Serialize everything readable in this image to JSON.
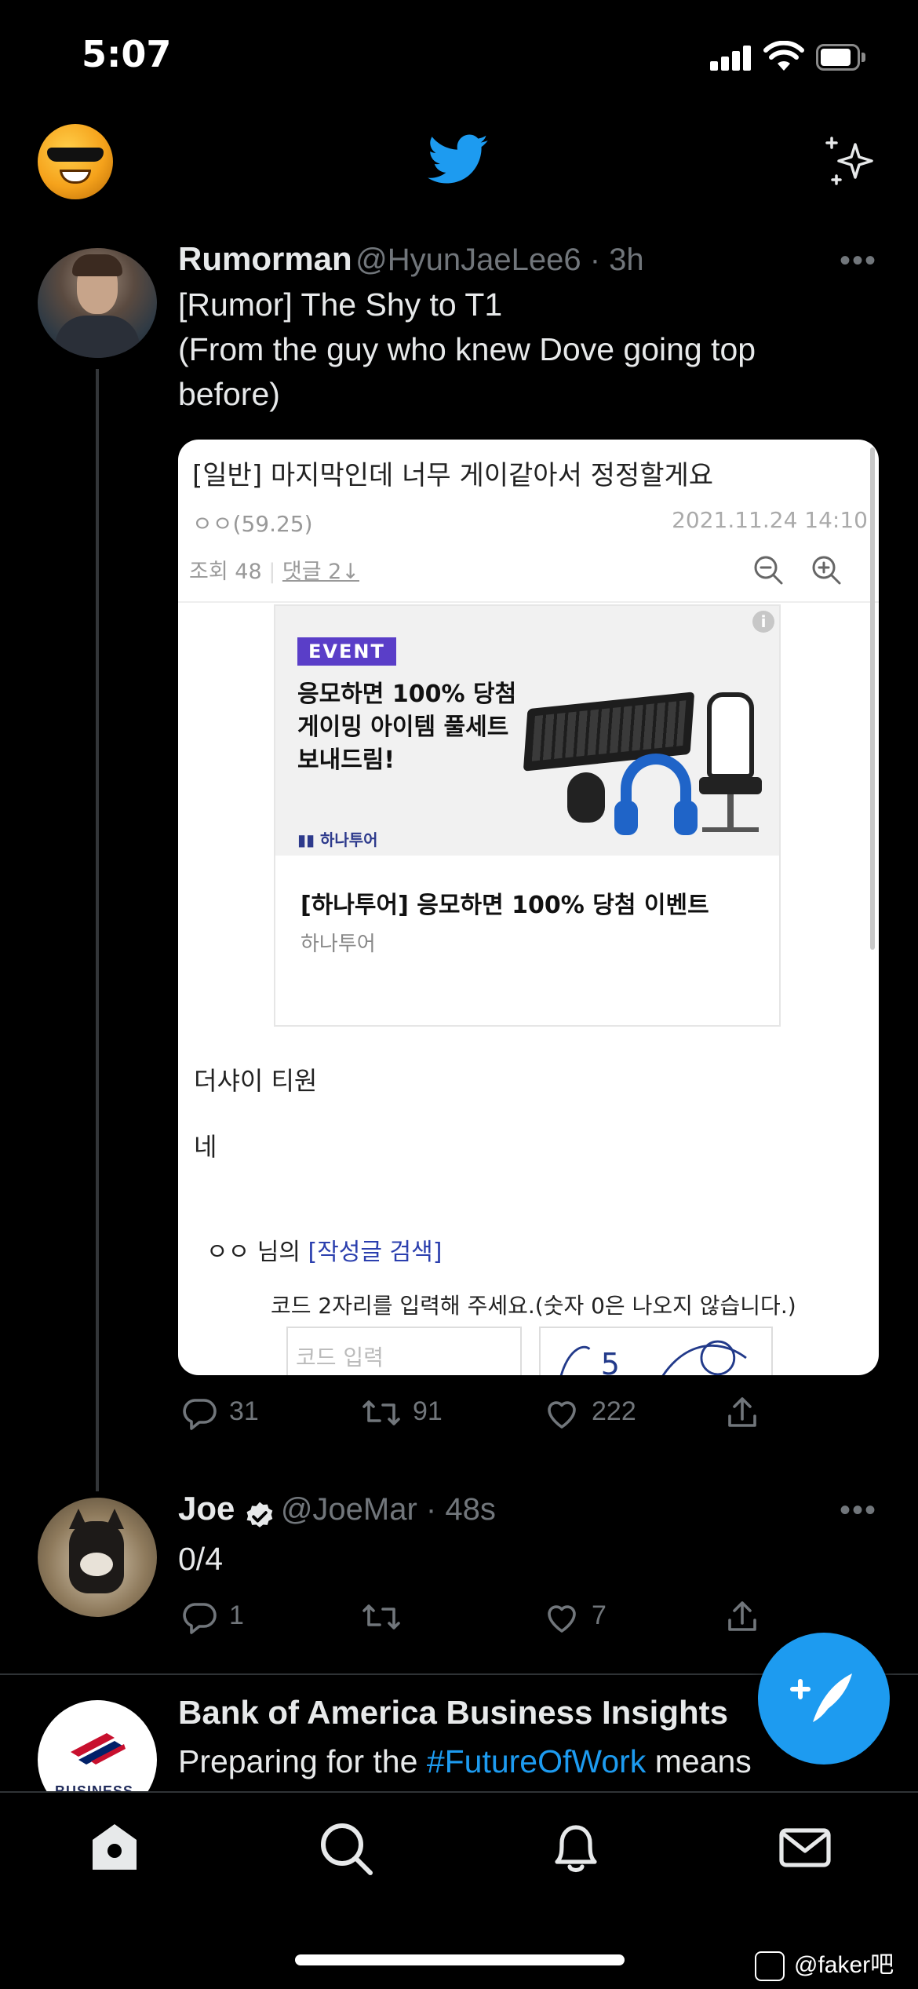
{
  "status_bar": {
    "time": "5:07"
  },
  "tweets": [
    {
      "name": "Rumorman",
      "handle": "@HyunJaeLee6",
      "age": "3h",
      "text_lines": [
        "[Rumor] The Shy to T1",
        "(From the guy who knew Dove going top",
        "before)"
      ],
      "replies": "31",
      "retweets": "91",
      "likes": "222",
      "embed": {
        "post_title": "[일반] 마지막인데 너무 게이같아서 정정할게요",
        "author": "ㅇㅇ(59.25)",
        "date": "2021.11.24 14:10",
        "views_label": "조회 48",
        "comments_label": "댓글 2↓",
        "ad": {
          "badge": "EVENT",
          "copy": "응모하면 100% 당첨\n게이밍 아이템 풀세트\n보내드림!",
          "brand": "하나투어",
          "title": "[하나투어] 응모하면 100% 당첨 이벤트",
          "subtitle": "하나투어",
          "info": "i"
        },
        "body_line1": "더샤이 티원",
        "body_line2": "네",
        "user_prefix": "ㅇㅇ 님의",
        "user_search_link": "[작성글 검색]",
        "captcha_prompt": "코드 2자리를 입력해 주세요.(숫자 0은 나오지 않습니다.)",
        "captcha_placeholder": "코드 입력",
        "captcha_value": "5"
      }
    },
    {
      "name": "Joe",
      "handle": "@JoeMar",
      "age": "48s",
      "text": "0/4",
      "replies": "1",
      "likes": "7"
    },
    {
      "name": "Bank of America Business Insights",
      "text_before": "Preparing for the",
      "hashtag": "#FutureOfWork",
      "text_after": "means",
      "avatar_text": "BUSINESS"
    }
  ],
  "watermark": "@faker吧",
  "colors": {
    "accent": "#1d9bf0",
    "background": "#000000",
    "text": "#e7e9ea",
    "muted": "#71767b"
  },
  "icons": [
    "bird-icon",
    "sparkle-icon",
    "reply-icon",
    "retweet-icon",
    "like-icon",
    "share-icon",
    "verified-icon",
    "compose-icon",
    "home-icon",
    "search-icon",
    "notifications-icon",
    "messages-icon"
  ]
}
